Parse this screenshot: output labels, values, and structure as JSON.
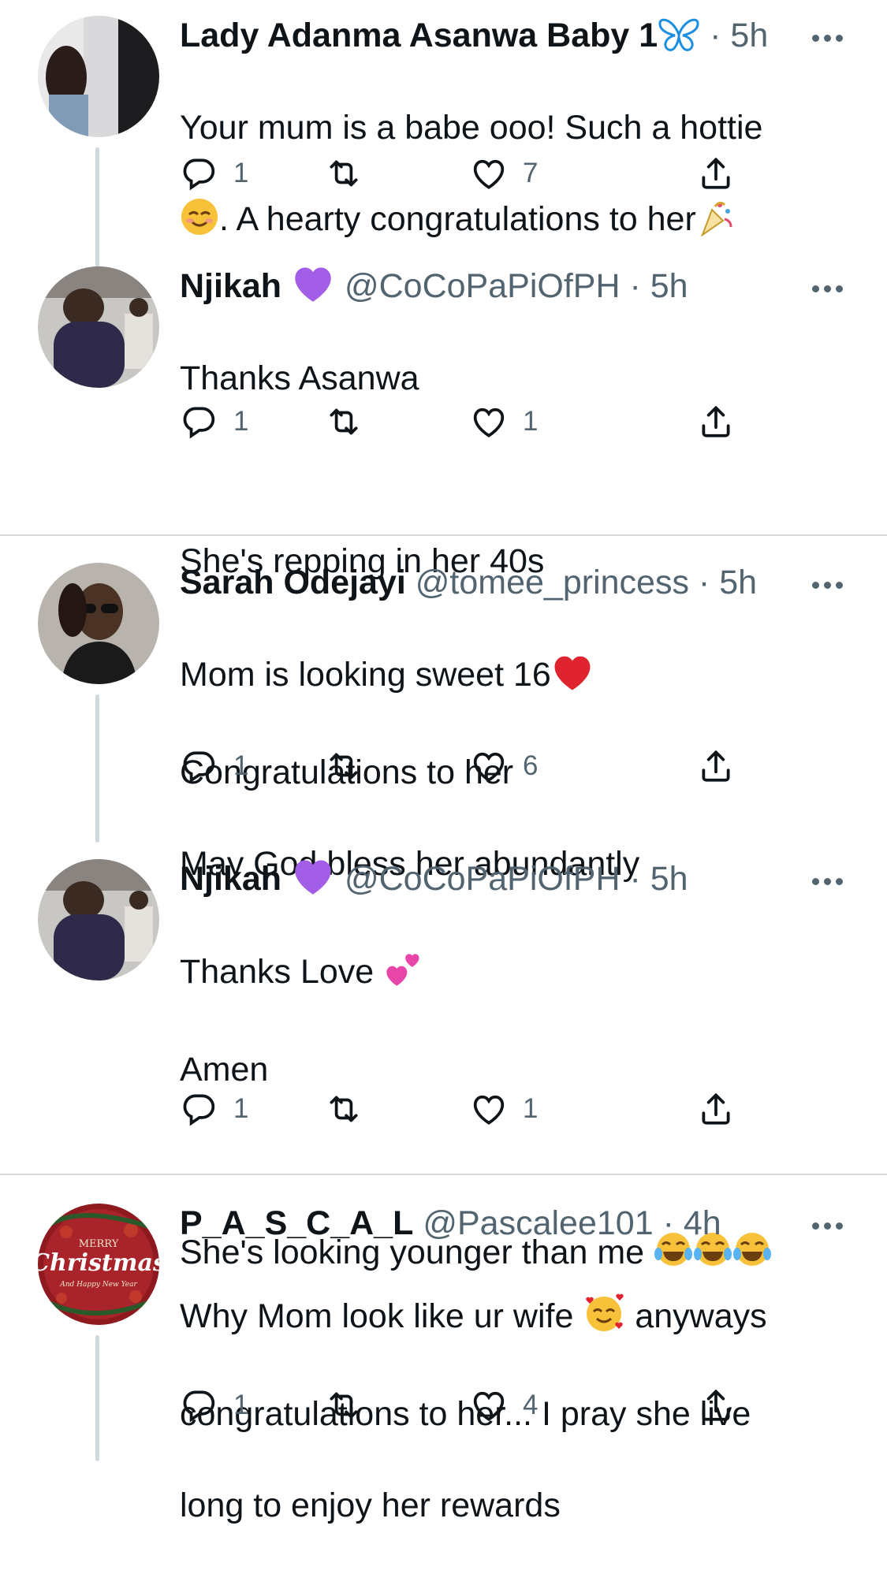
{
  "tweets": [
    {
      "name": "Lady Adanma Asanwa Baby 1",
      "handle": "",
      "sep": " · ",
      "time": "5h",
      "line1": "Your mum is a babe ooo! Such a hottie",
      "line2": ". A hearty congratulations to her",
      "replies": "1",
      "retweets": "",
      "likes": "7"
    },
    {
      "name": "Njikah",
      "handle": "@CoCoPaPiOfPH",
      "sep": " · ",
      "time": "5h",
      "line1": "Thanks Asanwa",
      "line2": "She's repping in her 40s",
      "replies": "1",
      "retweets": "",
      "likes": "1"
    },
    {
      "name": "Sarah Odejayi",
      "handle": "@tomee_princess",
      "sep": " · ",
      "time": "5h",
      "line1": "Mom is looking sweet 16",
      "line2": "Congratulations to her",
      "line3": "May God bless her abundantly",
      "replies": "1",
      "retweets": "",
      "likes": "6"
    },
    {
      "name": "Njikah",
      "handle": "@CoCoPaPiOfPH",
      "sep": " · ",
      "time": "5h",
      "line1": "Thanks Love",
      "line2": "Amen",
      "line3": "She's looking younger than me",
      "replies": "1",
      "retweets": "",
      "likes": "1"
    },
    {
      "name": "P_A_S_C_A_L",
      "handle": "@Pascalee101",
      "sep": " · ",
      "time": "4h",
      "line1a": "Why Mom look like ur wife",
      "line1b": "anyways",
      "line2": "congratulations to her... I pray she live",
      "line3": "long to enjoy her rewards",
      "replies": "1",
      "retweets": "",
      "likes": "4"
    }
  ],
  "avatar5": {
    "line1": "MERRY",
    "line2": "Christmas",
    "line3": "And Happy New Year"
  },
  "icons": {
    "reply": "reply-icon",
    "retweet": "retweet-icon",
    "like": "heart-icon",
    "share": "share-icon",
    "more": "more-icon"
  },
  "colors": {
    "purple_heart": "#a35ee8",
    "red_heart": "#e0242f",
    "text": "#0f1419",
    "muted": "#536471"
  }
}
